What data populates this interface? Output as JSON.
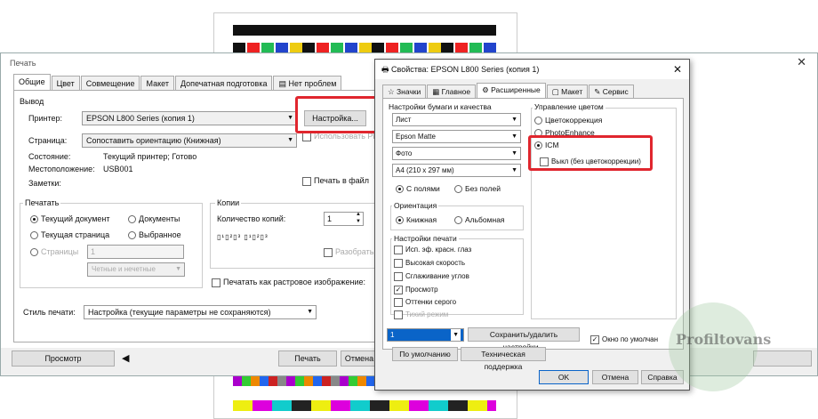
{
  "main_dialog": {
    "title": "Печать",
    "tabs": [
      "Общие",
      "Цвет",
      "Совмещение",
      "Макет",
      "Допечатная подготовка",
      "Нет проблем"
    ],
    "output_group": "Вывод",
    "printer_label": "Принтер:",
    "printer_value": "EPSON L800 Series (копия 1)",
    "settings_button": "Настройка...",
    "use_ppd": "Использовать PPD",
    "page_label": "Страница:",
    "page_value": "Сопоставить ориентацию (Книжная)",
    "status_label": "Состояние:",
    "status_value": "Текущий принтер; Готово",
    "location_label": "Местоположение:",
    "location_value": "USB001",
    "comments_label": "Заметки:",
    "print_to_file": "Печать в файл",
    "print_group": "Печатать",
    "current_doc": "Текущий документ",
    "documents": "Документы",
    "current_page": "Текущая страница",
    "selection": "Выбранное",
    "pages": "Страницы",
    "pages_value": "1",
    "pages_select": "Четные и нечетные",
    "copies_group": "Копии",
    "copies_label": "Количество копий:",
    "copies_value": "1",
    "collate": "Разобрать по копиям",
    "print_as_bitmap": "Печатать как растровое изображение:",
    "print_style_label": "Стиль печати:",
    "print_style_value": "Настройка (текущие параметры не сохраняются)",
    "preview_button": "Просмотр",
    "print_button": "Печать",
    "cancel_button": "Отмена"
  },
  "properties_dialog": {
    "title": "Свойства: EPSON L800 Series (копия 1)",
    "tabs": [
      "Значки",
      "Главное",
      "Расширенные",
      "Макет",
      "Сервис"
    ],
    "paper_quality_label": "Настройки бумаги и качества",
    "paper_source": "Лист",
    "paper_type": "Epson Matte",
    "quality": "Фото",
    "paper_size": "A4 (210 x 297 мм)",
    "with_borders": "С полями",
    "borderless": "Без полей",
    "orientation_label": "Ориентация",
    "portrait": "Книжная",
    "landscape": "Альбомная",
    "print_settings_label": "Настройки печати",
    "opt_mirror": "Исп. эф. красн. глаз",
    "opt_high_speed": "Высокая скорость",
    "opt_smooth": "Сглаживание углов",
    "opt_preview": "Просмотр",
    "opt_gray": "Оттенки серого",
    "opt_quiet": "Тихий режим",
    "color_mgmt_label": "Управление цветом",
    "color_correction": "Цветокоррекция",
    "photo_enhance": "PhotoEnhance",
    "icm": "ICM",
    "off_no_correction": "Выкл (без цветокоррекции)",
    "preset_value": "1",
    "save_delete_button": "Сохранить/удалить настройки...",
    "default_window": "Окно по умолчан",
    "default_button": "По умолчанию",
    "support_button": "Техническая поддержка",
    "ok_button": "OK",
    "cancel_button": "Отмена",
    "help_button": "Справка"
  },
  "watermark": "Profiltovans",
  "colors": {
    "highlight": "#e0262e",
    "accent": "#0a64c8"
  }
}
